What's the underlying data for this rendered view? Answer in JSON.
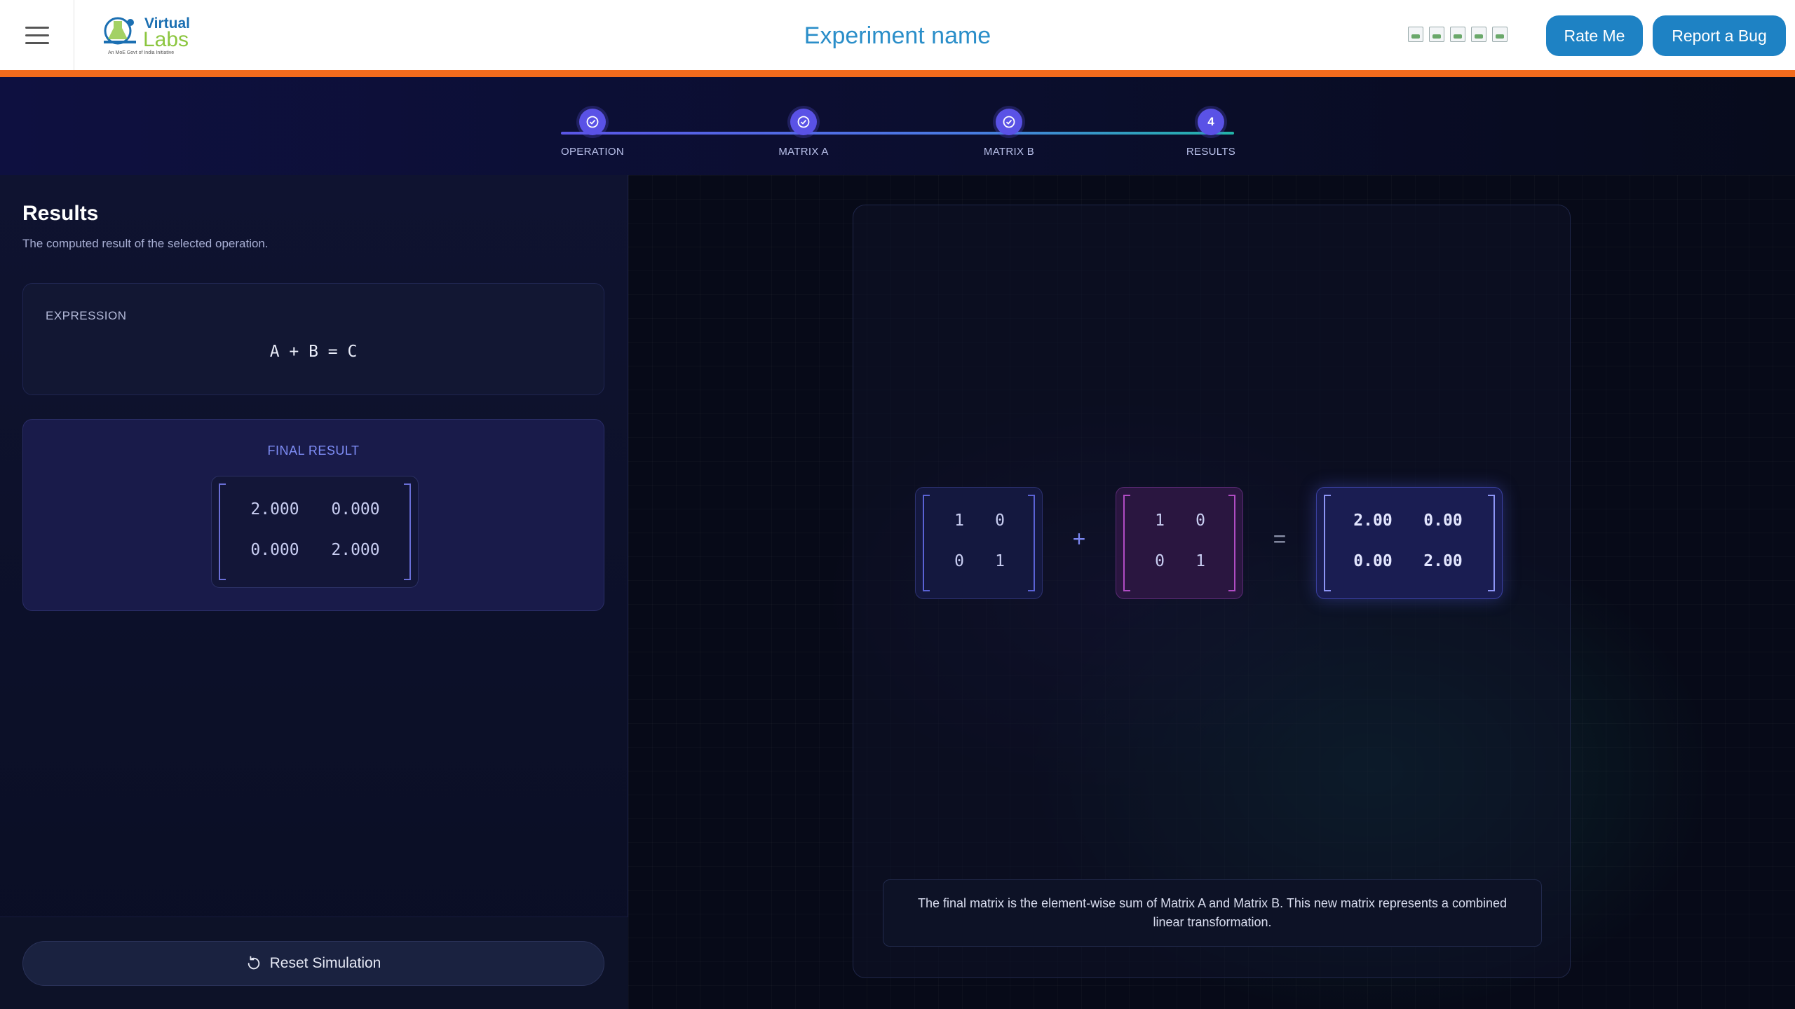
{
  "header": {
    "logo_line1": "Virtual",
    "logo_line2": "Labs",
    "logo_tagline": "An MoE Govt of India Initiative",
    "title": "Experiment name",
    "rate_label": "Rate Me",
    "bug_label": "Report a Bug"
  },
  "stepper": {
    "steps": [
      {
        "label": "OPERATION",
        "state": "done"
      },
      {
        "label": "MATRIX A",
        "state": "done"
      },
      {
        "label": "MATRIX B",
        "state": "done"
      },
      {
        "label": "RESULTS",
        "state": "current",
        "number": "4"
      }
    ]
  },
  "left": {
    "title": "Results",
    "subtitle": "The computed result of the selected operation.",
    "expression_label": "EXPRESSION",
    "expression": "A + B = C",
    "final_label": "FINAL RESULT",
    "final_matrix": [
      [
        "2.000",
        "0.000"
      ],
      [
        "0.000",
        "2.000"
      ]
    ],
    "reset_label": "Reset Simulation"
  },
  "viz": {
    "matrix_a": [
      [
        "1",
        "0"
      ],
      [
        "0",
        "1"
      ]
    ],
    "operator": "+",
    "matrix_b": [
      [
        "1",
        "0"
      ],
      [
        "0",
        "1"
      ]
    ],
    "equals": "=",
    "matrix_c": [
      [
        "2.00",
        "0.00"
      ],
      [
        "0.00",
        "2.00"
      ]
    ],
    "description": "The final matrix is the element-wise sum of Matrix A and Matrix B. This new matrix represents a combined linear transformation."
  },
  "colors": {
    "accent": "#5a52e6",
    "header_bar": "#f26b1d",
    "button": "#1e82c4"
  }
}
